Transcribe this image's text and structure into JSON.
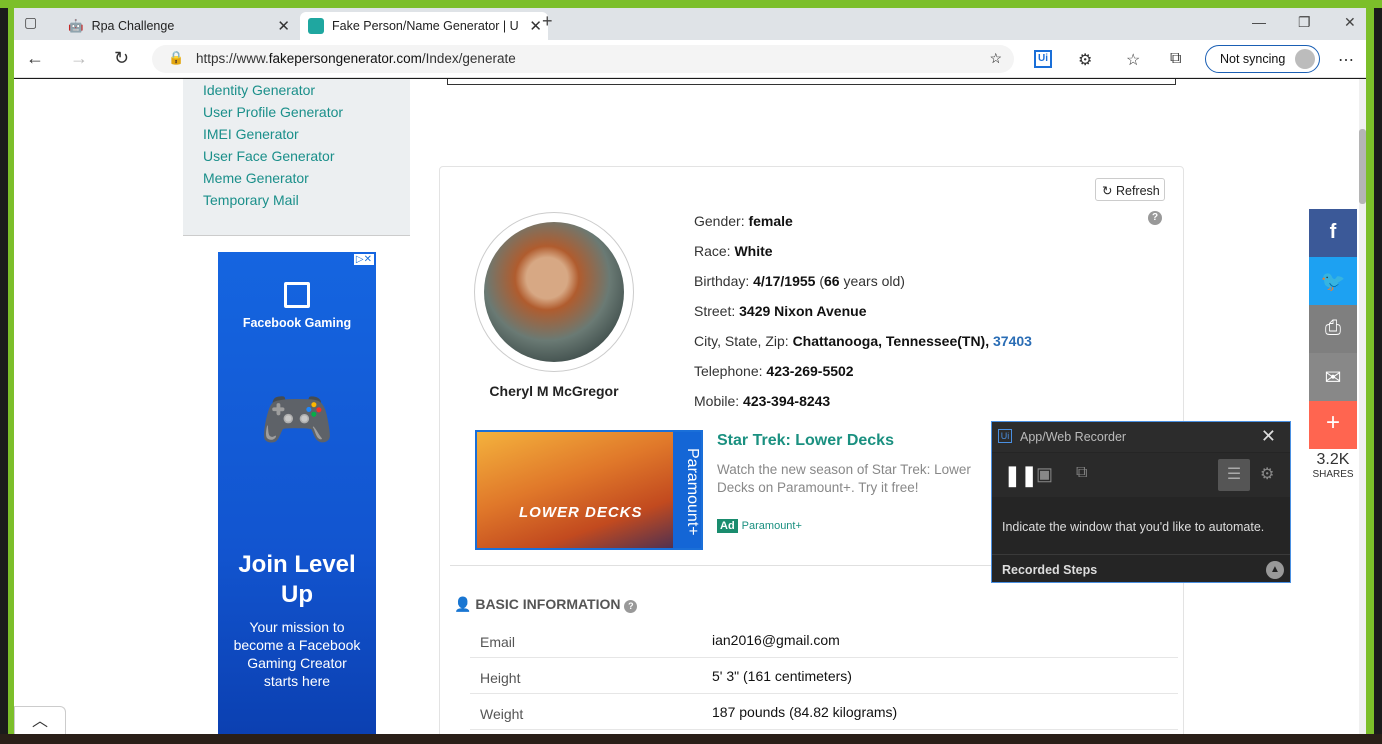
{
  "browser": {
    "tabs": [
      {
        "title": "Rpa Challenge"
      },
      {
        "title": "Fake Person/Name Generator | U"
      }
    ],
    "url_prefix": "https://www.",
    "url_domain": "fakepersongenerator.com",
    "url_path": "/Index/generate",
    "sync_label": "Not syncing"
  },
  "sidebar": {
    "links": [
      "Identity Generator",
      "User Profile Generator",
      "IMEI Generator",
      "User Face Generator",
      "Meme Generator",
      "Temporary Mail"
    ]
  },
  "ad_left": {
    "brand": "Facebook Gaming",
    "headline": "Join Level Up",
    "body": "Your mission to become a Facebook Gaming Creator starts here"
  },
  "person": {
    "name": "Cheryl M McGregor",
    "refresh_label": "Refresh",
    "gender_label": "Gender:",
    "gender": "female",
    "race_label": "Race:",
    "race": "White",
    "birthday_label": "Birthday:",
    "birthday": "4/17/1955",
    "age": "66",
    "age_suffix": "years old)",
    "street_label": "Street:",
    "street": "3429 Nixon Avenue",
    "city_label": "City, State, Zip:",
    "city": "Chattanooga, Tennessee(TN),",
    "zip": "37403",
    "telephone_label": "Telephone:",
    "telephone": "423-269-5502",
    "mobile_label": "Mobile:",
    "mobile": "423-394-8243"
  },
  "ad_mid": {
    "title": "Star Trek: Lower Decks",
    "text": "Watch the new season of Star Trek: Lower Decks on Paramount+. Try it free!",
    "badge": "Ad",
    "advertiser": "Paramount+",
    "image_text": "LOWER DECKS",
    "image_side": "Paramount+"
  },
  "basic_info": {
    "heading": "BASIC INFORMATION",
    "rows": [
      {
        "key": "Email",
        "value": "ian2016@gmail.com"
      },
      {
        "key": "Height",
        "value": "5' 3\" (161 centimeters)"
      },
      {
        "key": "Weight",
        "value": "187 pounds (84.82 kilograms)"
      }
    ]
  },
  "share": {
    "count": "3.2K",
    "label": "SHARES",
    "colors": {
      "facebook": "#3b5998",
      "twitter": "#1da1f2",
      "print": "#7f7f7f",
      "email": "#888888",
      "more": "#ff6550"
    }
  },
  "recorder": {
    "title": "App/Web Recorder",
    "message": "Indicate the window that you'd like to automate.",
    "steps_label": "Recorded Steps"
  }
}
